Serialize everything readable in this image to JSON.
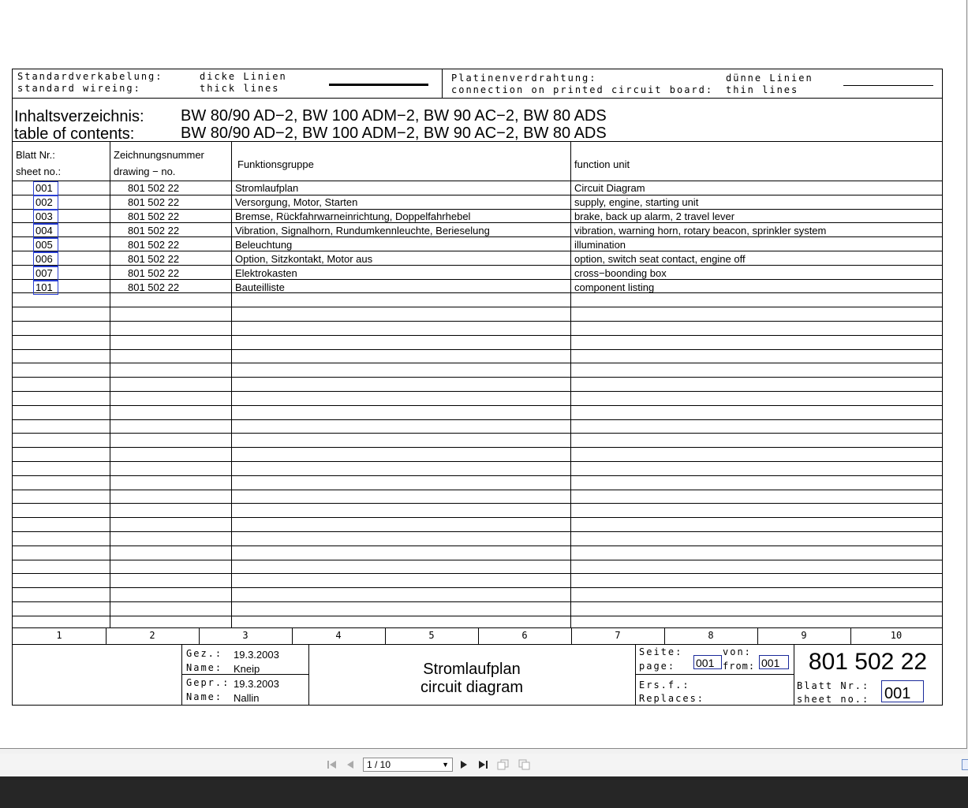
{
  "header": {
    "std_de": "Standardverkabelung:",
    "std_en": "standard wireing:",
    "thick_de": "dicke Linien",
    "thick_en": "thick lines",
    "pcb_de": "Platinenverdrahtung:",
    "pcb_en": "connection on printed circuit board:",
    "thin_de": "dünne Linien",
    "thin_en": "thin lines"
  },
  "toc": {
    "label_de": "Inhaltsverzeichnis:",
    "label_en": "table of contents:",
    "models_de": "BW 80/90 AD−2, BW 100 ADM−2, BW 90 AC−2, BW 80 ADS",
    "models_en": "BW 80/90 AD−2, BW 100 ADM−2, BW 90 AC−2, BW 80 ADS"
  },
  "columns": {
    "sheet_de": "Blatt Nr.:",
    "sheet_en": "sheet no.:",
    "drawing_de": "Zeichnungsnummer",
    "drawing_en": "drawing − no.",
    "function_de": "Funktionsgruppe",
    "function_en": "function unit"
  },
  "rows": [
    {
      "sheet": "001",
      "drawing": "801 502 22",
      "de": "Stromlaufplan",
      "en": "Circuit Diagram"
    },
    {
      "sheet": "002",
      "drawing": "801 502 22",
      "de": "Versorgung, Motor, Starten",
      "en": "supply, engine, starting unit"
    },
    {
      "sheet": "003",
      "drawing": "801 502 22",
      "de": "Bremse, Rückfahrwarneinrichtung, Doppelfahrhebel",
      "en": "brake, back up alarm, 2 travel lever"
    },
    {
      "sheet": "004",
      "drawing": "801 502 22",
      "de": "Vibration, Signalhorn, Rundumkennleuchte, Berieselung",
      "en": "vibration, warning horn, rotary beacon, sprinkler system"
    },
    {
      "sheet": "005",
      "drawing": "801 502 22",
      "de": "Beleuchtung",
      "en": "illumination"
    },
    {
      "sheet": "006",
      "drawing": "801 502 22",
      "de": "Option, Sitzkontakt, Motor aus",
      "en": "option, switch seat contact, engine off"
    },
    {
      "sheet": "007",
      "drawing": "801 502 22",
      "de": "Elektrokasten",
      "en": "cross−boonding box"
    },
    {
      "sheet": "101",
      "drawing": "801 502 22",
      "de": "Bauteilliste",
      "en": "component listing"
    }
  ],
  "grid_numbers": [
    "1",
    "2",
    "3",
    "4",
    "5",
    "6",
    "7",
    "8",
    "9",
    "10"
  ],
  "title_block": {
    "gez_label": "Gez.:",
    "gez_date": "19.3.2003",
    "name_label_1": "Name:",
    "name_1": "Kneip",
    "gepr_label": "Gepr.:",
    "gepr_date": "19.3.2003",
    "name_label_2": "Name:",
    "name_2": "Nallin",
    "title_de": "Stromlaufplan",
    "title_en": "circuit diagram",
    "seite_label": "Seite:",
    "page_label": "page:",
    "page_value": "001",
    "von_label": "von:",
    "from_label": "from:",
    "from_value": "001",
    "drawing_number": "801 502 22",
    "ersf_label": "Ers.f.:",
    "replaces_label": "Replaces:",
    "blatt_label": "Blatt Nr.:",
    "sheetno_label": "sheet no.:",
    "sheet_value": "001"
  },
  "viewer": {
    "page_indicator": "1 / 10"
  }
}
